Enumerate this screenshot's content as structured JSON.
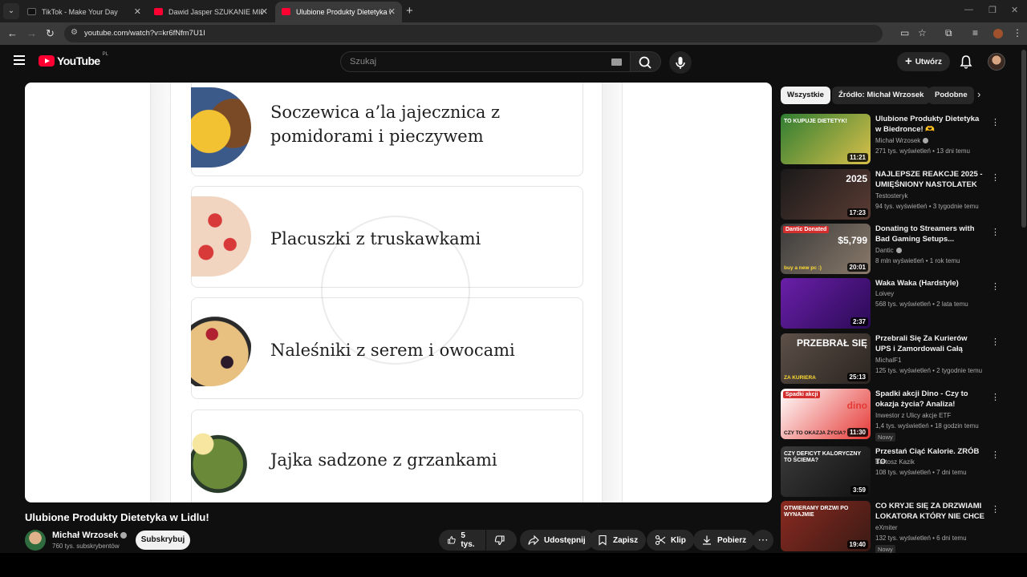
{
  "browser": {
    "tabs": [
      {
        "title": "TikTok - Make Your Day",
        "active": false,
        "favicon_color": "#111111"
      },
      {
        "title": "Dawid Jasper SZUKANIE MIŁOŚ",
        "active": false,
        "favicon_color": "#ff0033"
      },
      {
        "title": "Ulubione Produkty Dietetyka w",
        "active": true,
        "favicon_color": "#ff0033"
      }
    ],
    "url": "youtube.com/watch?v=kr6fNfm7U1I"
  },
  "header": {
    "logo_text": "YouTube",
    "country_code": "PL",
    "search_placeholder": "Szukaj",
    "create_label": "Utwórz"
  },
  "player": {
    "items": [
      {
        "label": "Soczewica a’la jajecznica z pomidorami i pieczywem",
        "line1": "Soczewica a’la jajecznica z",
        "line2": "pomidorami i pieczywem"
      },
      {
        "label": "Placuszki z truskawkami"
      },
      {
        "label": "Naleśniki z serem i owocami"
      },
      {
        "label": "Jajka sadzone z grzankami"
      }
    ]
  },
  "video": {
    "title": "Ulubione Produkty Dietetyka w Lidlu!",
    "channel": "Michał Wrzosek",
    "subscribers": "760 tys. subskrybentów",
    "subscribe_label": "Subskrybuj",
    "likes": "5 tys.",
    "share_label": "Udostępnij",
    "save_label": "Zapisz",
    "clip_label": "Klip",
    "download_label": "Pobierz"
  },
  "sidebar": {
    "chips": [
      "Wszystkie",
      "Źródło: Michał Wrzosek",
      "Podobne"
    ],
    "recommendations": [
      {
        "title": "Ulubione Produkty Dietetyka w Biedronce! 🫶",
        "channel": "Michał Wrzosek",
        "verified": true,
        "meta": "271 tys. wyświetleń • 13 dni temu",
        "duration": "11:21",
        "thumb_text": "TO KUPUJE DIETETYK!",
        "thumb_colors": [
          "#2f7d32",
          "#d9c04a"
        ]
      },
      {
        "title": "NAJLEPSZE REAKCJE 2025 - UMIĘŚNIONY NASTOLATEK ...",
        "channel": "Testosteryk",
        "verified": false,
        "meta": "94 tys. wyświetleń • 3 tygodnie temu",
        "duration": "17:23",
        "thumb_text": "2025",
        "thumb_colors": [
          "#1a1a1a",
          "#5a3b33"
        ]
      },
      {
        "title": "Donating to Streamers with Bad Gaming Setups...",
        "channel": "Dantic",
        "verified": true,
        "meta": "8 mln wyświetleń • 1 rok temu",
        "duration": "20:01",
        "thumb_text": "$5,799",
        "thumb_overlay": "Dantic Donated",
        "thumb_sub": "buy a new pc :)",
        "thumb_colors": [
          "#3b3b3b",
          "#8a7a6a"
        ]
      },
      {
        "title": "Waka Waka (Hardstyle)",
        "channel": "Loivey",
        "verified": false,
        "meta": "568 tys. wyświetleń • 2 lata temu",
        "duration": "2:37",
        "thumb_text": "",
        "thumb_colors": [
          "#6a1fa8",
          "#2a0a55"
        ]
      },
      {
        "title": "Przebrali Się Za Kurierów UPS i Zamordowali Całą Rodzinę",
        "channel": "MichalF1",
        "verified": false,
        "meta": "125 tys. wyświetleń • 2 tygodnie temu",
        "duration": "25:13",
        "thumb_text": "PRZEBRAŁ SIĘ",
        "thumb_sub": "ZA KURIERA",
        "thumb_colors": [
          "#5c5048",
          "#2b2420"
        ]
      },
      {
        "title": "Spadki akcji Dino - Czy to okazja życia? Analiza!",
        "channel": "Inwestor z Ulicy akcje ETF",
        "verified": false,
        "meta": "1,4 tys. wyświetleń • 18 godzin temu",
        "duration": "11:30",
        "thumb_text": "dino",
        "thumb_overlay": "Spadki akcji",
        "thumb_sub": "CZY TO OKAZJA ŻYCIA?",
        "thumb_colors": [
          "#ffffff",
          "#e53935"
        ],
        "badge": "Nowy"
      },
      {
        "title": "Przestań Ciąć Kalorie. ZRÓB TO",
        "channel": "Bartosz Kazik",
        "verified": false,
        "meta": "108 tys. wyświetleń • 7 dni temu",
        "duration": "3:59",
        "thumb_text": "CZY DEFICYT KALORYCZNY TO ŚCIEMA?",
        "thumb_colors": [
          "#3a3a3a",
          "#111111"
        ]
      },
      {
        "title": "CO KRYJE SIĘ ZA DRZWIAMI LOKATORA KTÓRY NIE CHCE ...",
        "channel": "eXmiter",
        "verified": false,
        "meta": "132 tys. wyświetleń • 6 dni temu",
        "duration": "19:40",
        "thumb_text": "OTWIERAMY DRZWI PO WYNAJMIE",
        "thumb_colors": [
          "#8a2a20",
          "#3a1a14"
        ],
        "badge": "Nowy"
      }
    ]
  },
  "colors": {
    "accent": "#ff0033",
    "background": "#0f0f0f",
    "chip_bg": "#272727"
  }
}
